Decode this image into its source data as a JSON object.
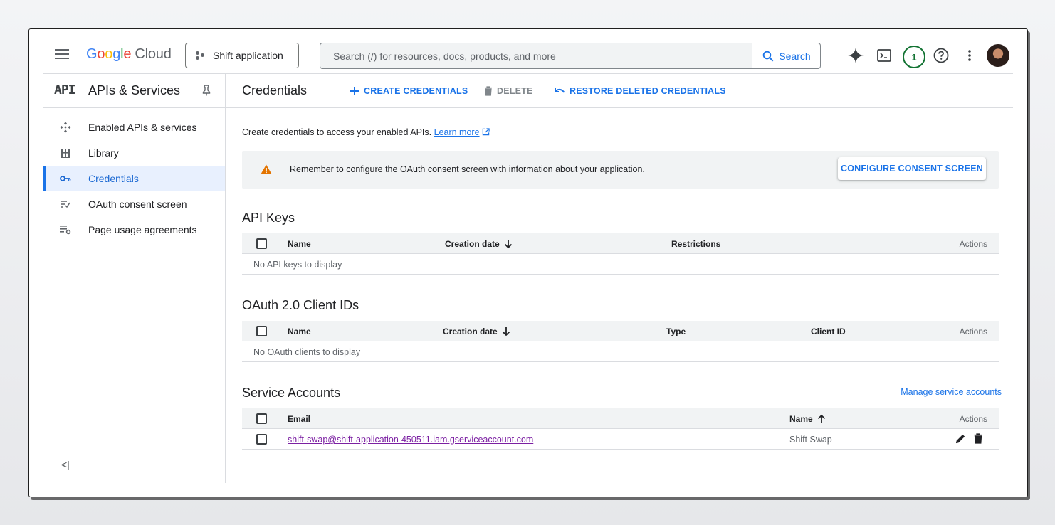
{
  "header": {
    "logo_parts": [
      "G",
      "o",
      "o",
      "g",
      "l",
      "e"
    ],
    "logo_cloud": "Cloud",
    "project": "Shift application",
    "search_placeholder": "Search (/) for resources, docs, products, and more",
    "search_button": "Search",
    "notifications_count": "1"
  },
  "sidebar": {
    "api_logo": "API",
    "title": "APIs & Services",
    "items": [
      {
        "label": "Enabled APIs & services",
        "icon": "diamond-nodes-icon"
      },
      {
        "label": "Library",
        "icon": "library-icon"
      },
      {
        "label": "Credentials",
        "icon": "key-icon",
        "active": true
      },
      {
        "label": "OAuth consent screen",
        "icon": "consent-icon"
      },
      {
        "label": "Page usage agreements",
        "icon": "settings-list-icon"
      }
    ],
    "collapse": "<|"
  },
  "toolbar": {
    "title": "Credentials",
    "create": "CREATE CREDENTIALS",
    "delete": "DELETE",
    "restore": "RESTORE DELETED CREDENTIALS"
  },
  "intro": {
    "text": "Create credentials to access your enabled APIs.",
    "learn_more": "Learn more"
  },
  "alert": {
    "message": "Remember to configure the OAuth consent screen with information about your application.",
    "button": "CONFIGURE CONSENT SCREEN"
  },
  "api_keys": {
    "title": "API Keys",
    "columns": {
      "name": "Name",
      "creation_date": "Creation date",
      "restrictions": "Restrictions",
      "actions": "Actions"
    },
    "empty": "No API keys to display"
  },
  "oauth": {
    "title": "OAuth 2.0 Client IDs",
    "columns": {
      "name": "Name",
      "creation_date": "Creation date",
      "type": "Type",
      "client_id": "Client ID",
      "actions": "Actions"
    },
    "empty": "No OAuth clients to display"
  },
  "service_accounts": {
    "title": "Service Accounts",
    "manage": "Manage service accounts",
    "columns": {
      "email": "Email",
      "name": "Name",
      "actions": "Actions"
    },
    "rows": [
      {
        "email": "shift-swap@shift-application-450511.iam.gserviceaccount.com",
        "name": "Shift Swap"
      }
    ]
  },
  "colors": {
    "accent": "#1a73e8",
    "warning": "#e37400",
    "badge": "#137333",
    "link_visited": "#7b1fa2"
  }
}
